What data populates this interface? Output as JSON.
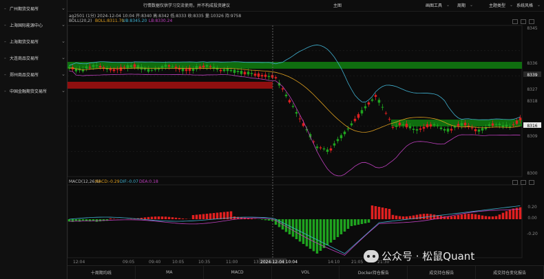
{
  "sidebar": {
    "items": [
      {
        "label": "广州期货交易所",
        "top": 4
      },
      {
        "label": "上海国际能源中心",
        "top": 28
      },
      {
        "label": "上海期货交易所",
        "top": 52
      },
      {
        "label": "大连商品交易所",
        "top": 76
      },
      {
        "label": "郑州商品交易所",
        "top": 100
      },
      {
        "label": "中国金融期货交易所",
        "top": 124
      }
    ]
  },
  "topbar": {
    "notice": "行情数据仅供学习交流使用，并不构成投资建议",
    "center": "主图",
    "menus": [
      "画图工具",
      "周期",
      "主题类型",
      "系统风格"
    ]
  },
  "header": {
    "line1": "ag2501 (1分)  2024-12-04  10:04  开:8340  高:8342  低:8333  收:8335  量:10326  持:9758",
    "line2_prefix": "BOLL(20,2)",
    "boll_label": "BOLL:8311.70",
    "ub_label": "UB:8345.20",
    "lb_label": "LB:8330.24"
  },
  "price_axis": [
    "8345",
    "8336",
    "8327",
    "8318",
    "8309",
    "8300"
  ],
  "price_tags": {
    "upper": "8339",
    "lower": "8316"
  },
  "macd_header": {
    "prefix": "MACD(12,26,9)",
    "macd": "MACD:-0.29",
    "dif": "DIF:-0.07",
    "dea": "DEA:0.18"
  },
  "macd_axis": [
    "0.20",
    "0.00",
    "-0.20"
  ],
  "time_axis": [
    "12:04",
    "09:05",
    "09:40",
    "10:05",
    "10:35",
    "11:00",
    "13:45",
    "14:10",
    "21:05",
    "21:30"
  ],
  "crosshair_time": "2024-12-04 10:04",
  "tabs": [
    "十周期均线",
    "MA",
    "MACD",
    "VOL",
    "Docker持仓报告",
    "成交持仓报告",
    "成交持仓变化报告"
  ],
  "watermark": "公众号 · 松鼠Quant",
  "colors": {
    "up": "#e02020",
    "down": "#1fa31f",
    "boll_mid": "#e0a020",
    "boll_ub": "#40b0d0",
    "boll_lb": "#c040c0",
    "zone_green": "#0f6e0f",
    "zone_red": "#8f0f0f"
  },
  "chart_data": {
    "type": "candlestick+macd",
    "symbol": "ag2501",
    "period": "1分",
    "y_range": [
      8291,
      8350
    ],
    "macd_range": [
      -0.32,
      0.24
    ]
  }
}
